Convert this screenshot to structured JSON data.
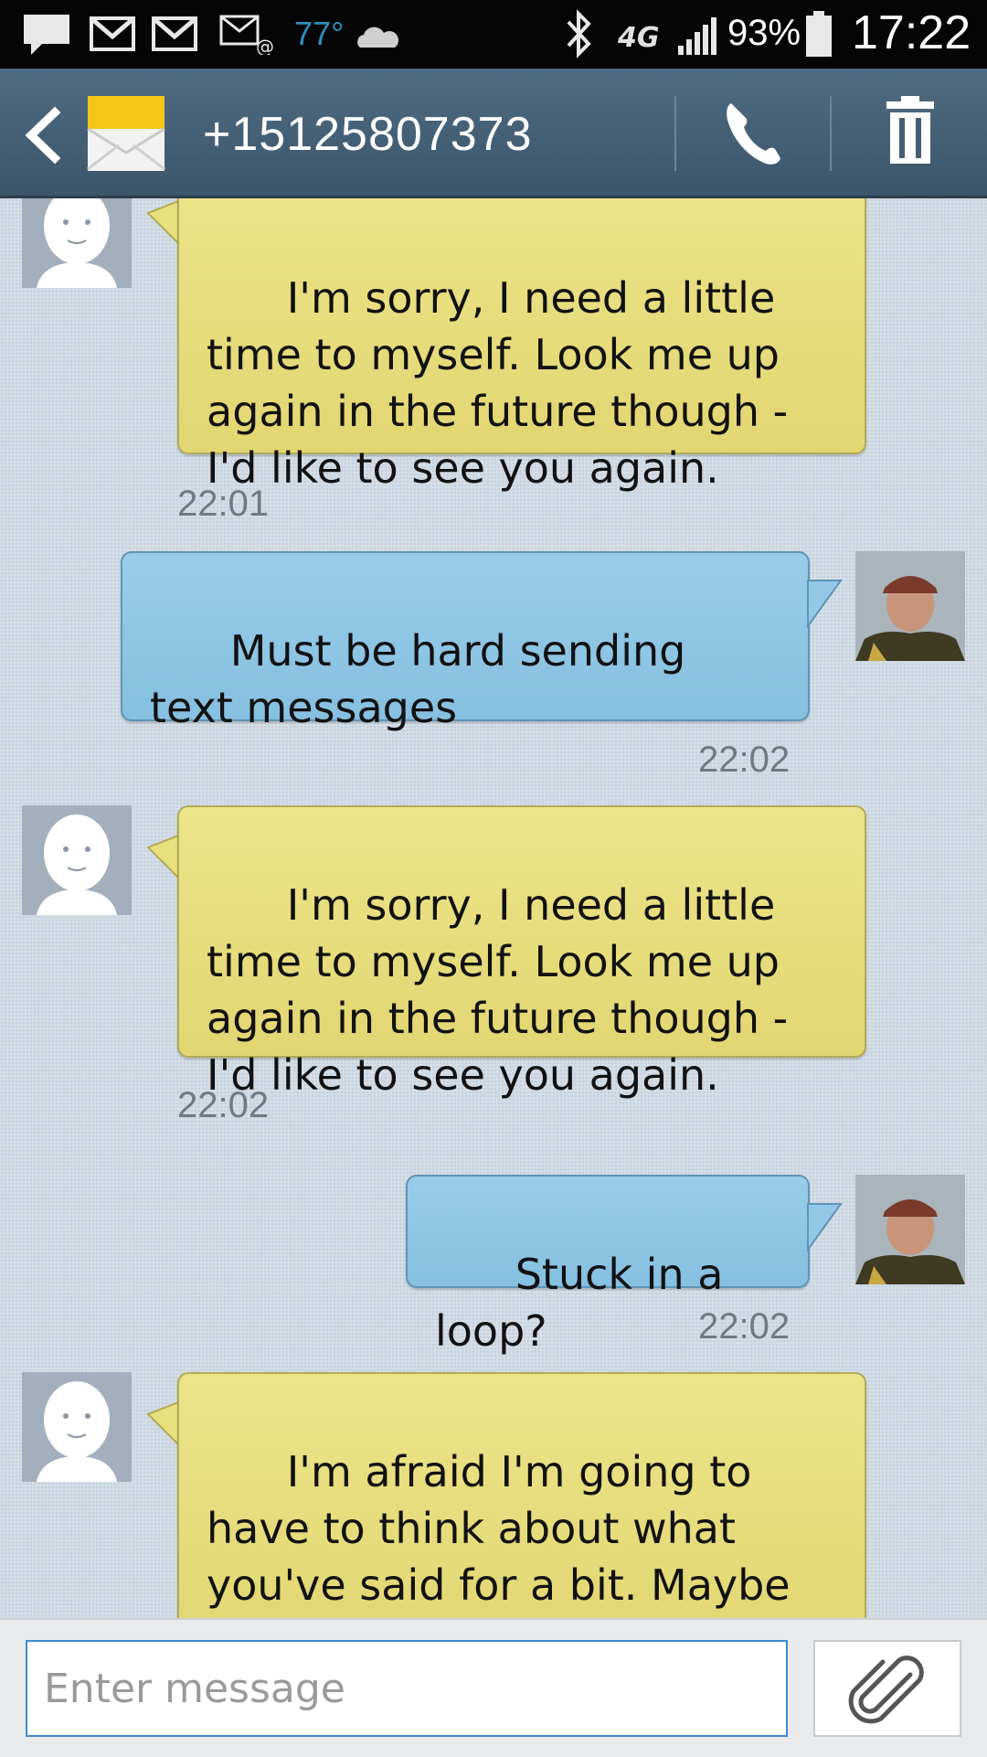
{
  "status_bar": {
    "weather_temp": "77°",
    "network_label": "4G",
    "battery_percent": "93%",
    "time": "17:22",
    "icons": [
      "message-notification-icon",
      "gmail-icon",
      "gmail-icon",
      "email-icon",
      "weather-cloud-icon",
      "bluetooth-icon",
      "signal-icon",
      "battery-icon"
    ]
  },
  "header": {
    "contact_number": "+15125807373",
    "back_icon": "chevron-left-icon",
    "contact_icon": "envelope-icon",
    "call_icon": "phone-icon",
    "delete_icon": "trash-icon"
  },
  "messages": [
    {
      "direction": "in",
      "text": "I'm sorry, I need a little time to myself. Look me up again in the future though - I'd like to see you again.",
      "time": "22:01"
    },
    {
      "direction": "out",
      "text": "Must be hard sending text messages",
      "time": "22:02"
    },
    {
      "direction": "in",
      "text": "I'm sorry, I need a little time to myself. Look me up again in the future though - I'd like to see you again.",
      "time": "22:02"
    },
    {
      "direction": "out",
      "text": "Stuck in a loop?",
      "time": "22:02"
    },
    {
      "direction": "in",
      "text": "I'm afraid I'm going to have to think about what you've said for a bit. Maybe come back later.",
      "time": ""
    }
  ],
  "composer": {
    "placeholder": "Enter message",
    "attach_icon": "paperclip-icon"
  },
  "colors": {
    "incoming_bubble": "#e6dd7c",
    "outgoing_bubble": "#8fc5e6",
    "header_bg": "#445f74",
    "conversation_bg": "#d3dde6",
    "input_border": "#3d8bd0"
  }
}
